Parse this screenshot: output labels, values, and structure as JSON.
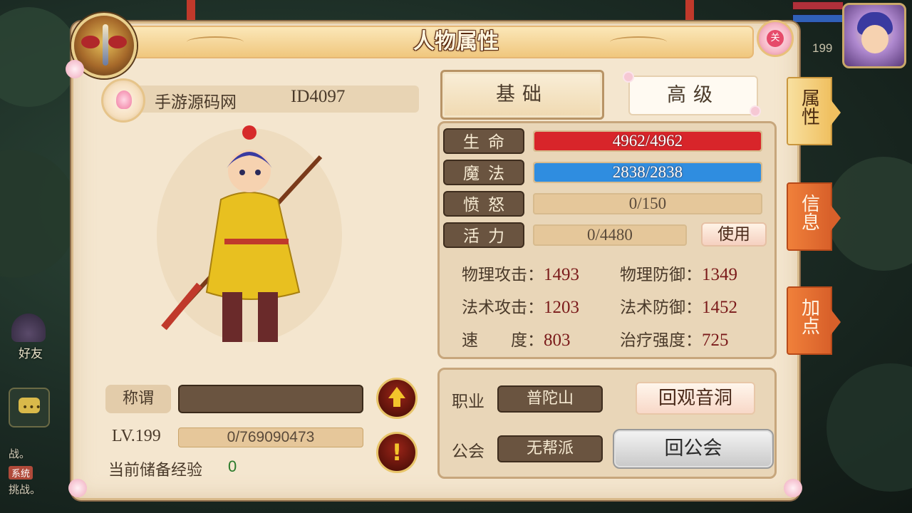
{
  "window": {
    "title": "人物属性",
    "close_label": "关"
  },
  "character": {
    "name": "手游源码网",
    "id": "ID4097",
    "title_label": "称谓",
    "title_value": "",
    "level": "LV.199",
    "exp_text": "0/769090473",
    "stored_exp_label": "当前储备经验",
    "stored_exp_value": "0"
  },
  "tabs": {
    "basic": "基础",
    "advanced": "高级"
  },
  "bars": {
    "hp": {
      "label": "生命",
      "text": "4962/4962",
      "fraction": 1.0,
      "color": "#d8252a"
    },
    "mp": {
      "label": "魔法",
      "text": "2838/2838",
      "fraction": 1.0,
      "color": "#2f8de0"
    },
    "rage": {
      "label": "愤怒",
      "text": "0/150",
      "fraction": 0.0
    },
    "vitality": {
      "label": "活力",
      "text": "0/4480",
      "fraction": 0.0,
      "use_label": "使用"
    }
  },
  "attributes": {
    "phys_atk": {
      "label": "物理攻击：",
      "value": "1493"
    },
    "phys_def": {
      "label": "物理防御：",
      "value": "1349"
    },
    "magic_atk": {
      "label": "法术攻击：",
      "value": "1203"
    },
    "magic_def": {
      "label": "法术防御：",
      "value": "1452"
    },
    "speed": {
      "label": "速　　度：",
      "value": "803"
    },
    "heal": {
      "label": "治疗强度：",
      "value": "725"
    }
  },
  "job": {
    "job_label": "职业",
    "job_value": "普陀山",
    "guild_label": "公会",
    "guild_value": "无帮派",
    "goto_button": "回观音洞",
    "guild_button": "回公会"
  },
  "side_tabs": [
    "属性",
    "信息",
    "加点"
  ],
  "hud": {
    "level": "199",
    "friends_label": "好友"
  },
  "chat": {
    "line1": "战。",
    "tag": "系统",
    "line2": "挑战。"
  }
}
